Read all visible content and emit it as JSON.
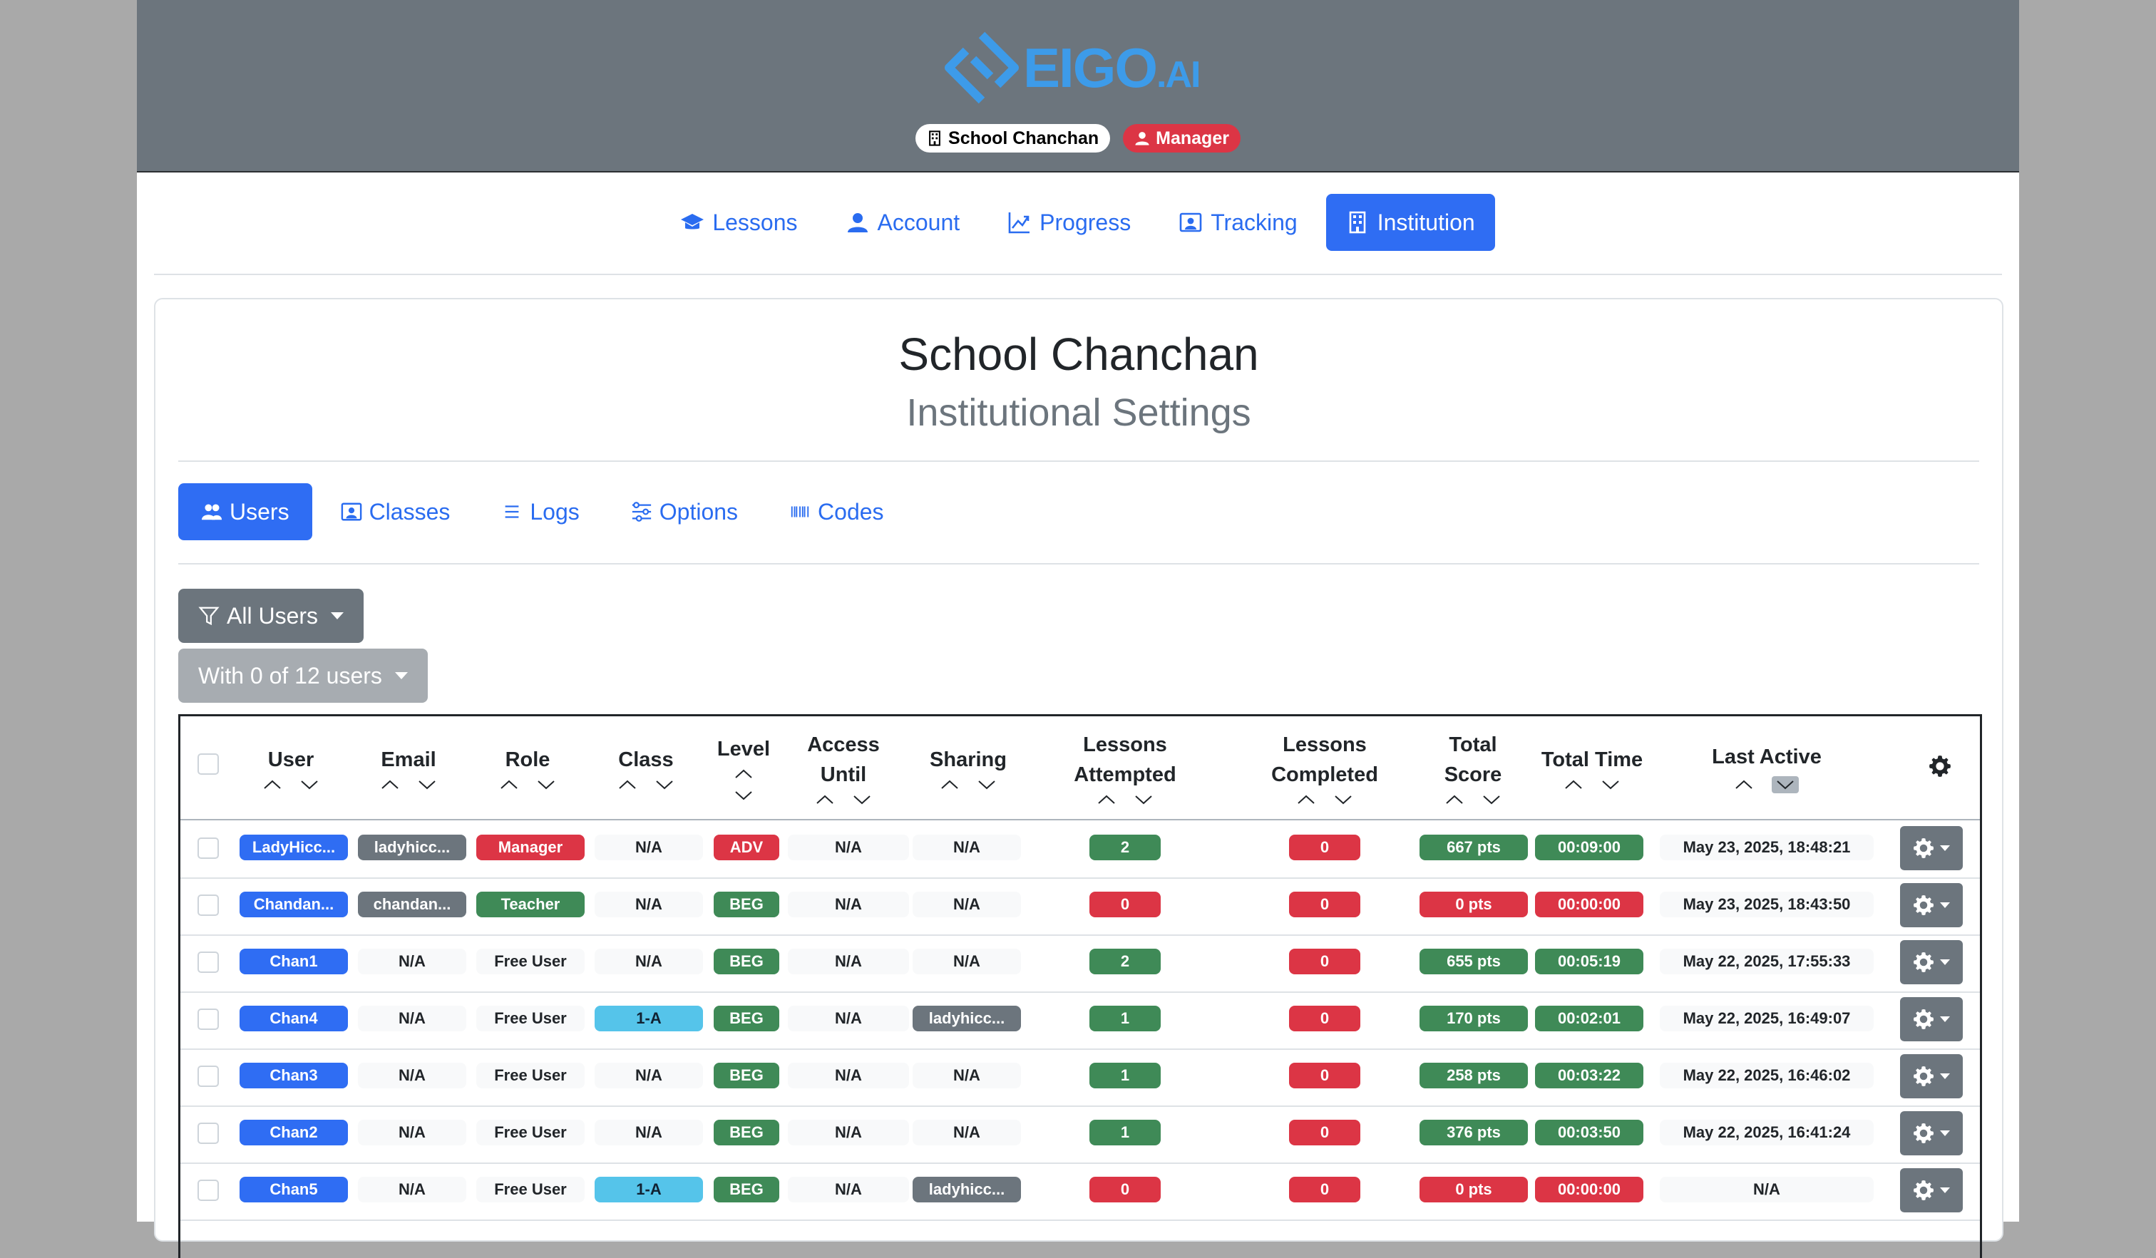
{
  "header": {
    "logo_main": "EIGO",
    "logo_suffix": ".AI",
    "school_badge": "School Chanchan",
    "role_badge": "Manager"
  },
  "main_nav": [
    {
      "label": "Lessons",
      "icon": "graduation-cap-icon"
    },
    {
      "label": "Account",
      "icon": "person-icon"
    },
    {
      "label": "Progress",
      "icon": "graph-up-icon"
    },
    {
      "label": "Tracking",
      "icon": "person-badge-icon"
    },
    {
      "label": "Institution",
      "icon": "building-icon",
      "active": true
    }
  ],
  "page": {
    "title": "School Chanchan",
    "subtitle": "Institutional Settings"
  },
  "sub_nav": [
    {
      "label": "Users",
      "icon": "people-icon",
      "active": true
    },
    {
      "label": "Classes",
      "icon": "person-video-icon"
    },
    {
      "label": "Logs",
      "icon": "list-icon"
    },
    {
      "label": "Options",
      "icon": "sliders-icon"
    },
    {
      "label": "Codes",
      "icon": "barcode-icon"
    }
  ],
  "filter": {
    "label": "All Users",
    "selection_label": "With 0 of 12 users"
  },
  "table": {
    "headers": {
      "user": "User",
      "email": "Email",
      "role": "Role",
      "class": "Class",
      "level": "Level",
      "access_1": "Access",
      "access_2": "Until",
      "sharing": "Sharing",
      "attempted_1": "Lessons",
      "attempted_2": "Attempted",
      "completed_1": "Lessons",
      "completed_2": "Completed",
      "score_1": "Total",
      "score_2": "Score",
      "time": "Total Time",
      "last_active": "Last Active"
    },
    "rows": [
      {
        "user": "LadyHicc...",
        "email": "ladyhicc...",
        "role": "Manager",
        "role_style": "red",
        "class": "N/A",
        "class_style": "light",
        "level": "ADV",
        "level_style": "red",
        "access": "N/A",
        "sharing": "N/A",
        "sharing_style": "light",
        "attempted": "2",
        "attempted_style": "green",
        "completed": "0",
        "score": "667 pts",
        "score_style": "green",
        "time": "00:09:00",
        "time_style": "green",
        "last_active": "May 23, 2025, 18:48:21"
      },
      {
        "user": "Chandan...",
        "email": "chandan...",
        "role": "Teacher",
        "role_style": "green",
        "class": "N/A",
        "class_style": "light",
        "level": "BEG",
        "level_style": "green",
        "access": "N/A",
        "sharing": "N/A",
        "sharing_style": "light",
        "attempted": "0",
        "attempted_style": "red",
        "completed": "0",
        "score": "0 pts",
        "score_style": "red",
        "time": "00:00:00",
        "time_style": "red",
        "last_active": "May 23, 2025, 18:43:50"
      },
      {
        "user": "Chan1",
        "email": "N/A",
        "role": "Free User",
        "role_style": "light",
        "class": "N/A",
        "class_style": "light",
        "level": "BEG",
        "level_style": "green",
        "access": "N/A",
        "sharing": "N/A",
        "sharing_style": "light",
        "attempted": "2",
        "attempted_style": "green",
        "completed": "0",
        "score": "655 pts",
        "score_style": "green",
        "time": "00:05:19",
        "time_style": "green",
        "last_active": "May 22, 2025, 17:55:33"
      },
      {
        "user": "Chan4",
        "email": "N/A",
        "role": "Free User",
        "role_style": "light",
        "class": "1-A",
        "class_style": "teal",
        "level": "BEG",
        "level_style": "green",
        "access": "N/A",
        "sharing": "ladyhicc...",
        "sharing_style": "gray",
        "attempted": "1",
        "attempted_style": "green",
        "completed": "0",
        "score": "170 pts",
        "score_style": "green",
        "time": "00:02:01",
        "time_style": "green",
        "last_active": "May 22, 2025, 16:49:07"
      },
      {
        "user": "Chan3",
        "email": "N/A",
        "role": "Free User",
        "role_style": "light",
        "class": "N/A",
        "class_style": "light",
        "level": "BEG",
        "level_style": "green",
        "access": "N/A",
        "sharing": "N/A",
        "sharing_style": "light",
        "attempted": "1",
        "attempted_style": "green",
        "completed": "0",
        "score": "258 pts",
        "score_style": "green",
        "time": "00:03:22",
        "time_style": "green",
        "last_active": "May 22, 2025, 16:46:02"
      },
      {
        "user": "Chan2",
        "email": "N/A",
        "role": "Free User",
        "role_style": "light",
        "class": "N/A",
        "class_style": "light",
        "level": "BEG",
        "level_style": "green",
        "access": "N/A",
        "sharing": "N/A",
        "sharing_style": "light",
        "attempted": "1",
        "attempted_style": "green",
        "completed": "0",
        "score": "376 pts",
        "score_style": "green",
        "time": "00:03:50",
        "time_style": "green",
        "last_active": "May 22, 2025, 16:41:24"
      },
      {
        "user": "Chan5",
        "email": "N/A",
        "role": "Free User",
        "role_style": "light",
        "class": "1-A",
        "class_style": "teal",
        "level": "BEG",
        "level_style": "green",
        "access": "N/A",
        "sharing": "ladyhicc...",
        "sharing_style": "gray",
        "attempted": "0",
        "attempted_style": "red",
        "completed": "0",
        "score": "0 pts",
        "score_style": "red",
        "time": "00:00:00",
        "time_style": "red",
        "last_active": "N/A"
      }
    ]
  },
  "colors": {
    "brand_blue": "#3d9be9",
    "primary": "#2f6df3",
    "header_bg": "#6c757d",
    "danger": "#dc3545",
    "success": "#3f8a57",
    "info": "#55c4ea"
  }
}
